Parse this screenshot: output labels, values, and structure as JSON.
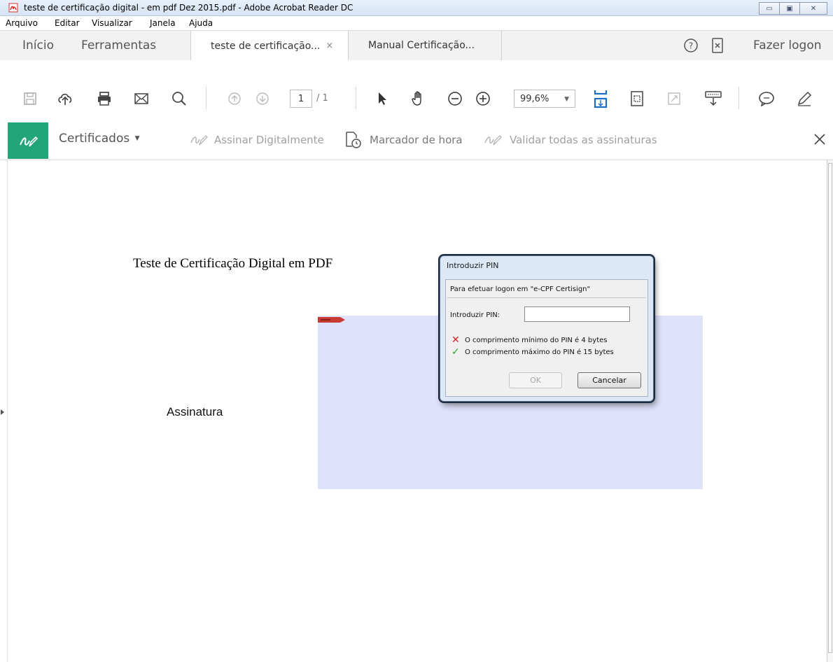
{
  "window": {
    "title": "teste de certificação digital - em pdf Dez 2015.pdf - Adobe Acrobat Reader DC",
    "controls": [
      "minimize",
      "maximize",
      "close"
    ]
  },
  "menu": [
    "Arquivo",
    "Editar",
    "Visualizar",
    "Janela",
    "Ajuda"
  ],
  "tabs": {
    "home": "Início",
    "tools": "Ferramentas",
    "documents": [
      {
        "label": "teste de certificação...",
        "close": "×",
        "active": true
      },
      {
        "label": "Manual Certificação...",
        "active": false
      }
    ],
    "login": "Fazer logon"
  },
  "toolbar": {
    "page_current": "1",
    "page_total": "/ 1",
    "zoom": "99,6%",
    "icons": [
      "save-icon",
      "upload-cloud-icon",
      "print-icon",
      "email-icon",
      "search-icon",
      "page-up-icon",
      "page-down-icon",
      "select-arrow-icon",
      "hand-icon",
      "zoom-out-icon",
      "zoom-in-icon",
      "fit-page-icon",
      "page-view-icon",
      "fullscreen-icon",
      "keyboard-icon",
      "comment-icon",
      "pen-icon"
    ]
  },
  "certificates_bar": {
    "menu_label": "Certificados",
    "sign_digitally": "Assinar Digitalmente",
    "timestamp": "Marcador de hora",
    "validate_all": "Validar todas as assinaturas",
    "accent_color": "#22a579"
  },
  "document": {
    "heading": "Teste de Certificação Digital em PDF",
    "signature_label": "Assinatura",
    "signature_field_color": "#dfe2fb"
  },
  "dialog": {
    "title": "Introduzir PIN",
    "logon_text": "Para efetuar logon em \"e-CPF Certisign\"",
    "pin_label": "Introduzir PIN:",
    "pin_value": "",
    "rule_min": "O comprimento mínimo do PIN é 4 bytes",
    "rule_max": "O comprimento máximo do PIN é 15 bytes",
    "ok_label": "OK",
    "cancel_label": "Cancelar",
    "fail_color": "#d0202a",
    "pass_color": "#2aa52a"
  }
}
